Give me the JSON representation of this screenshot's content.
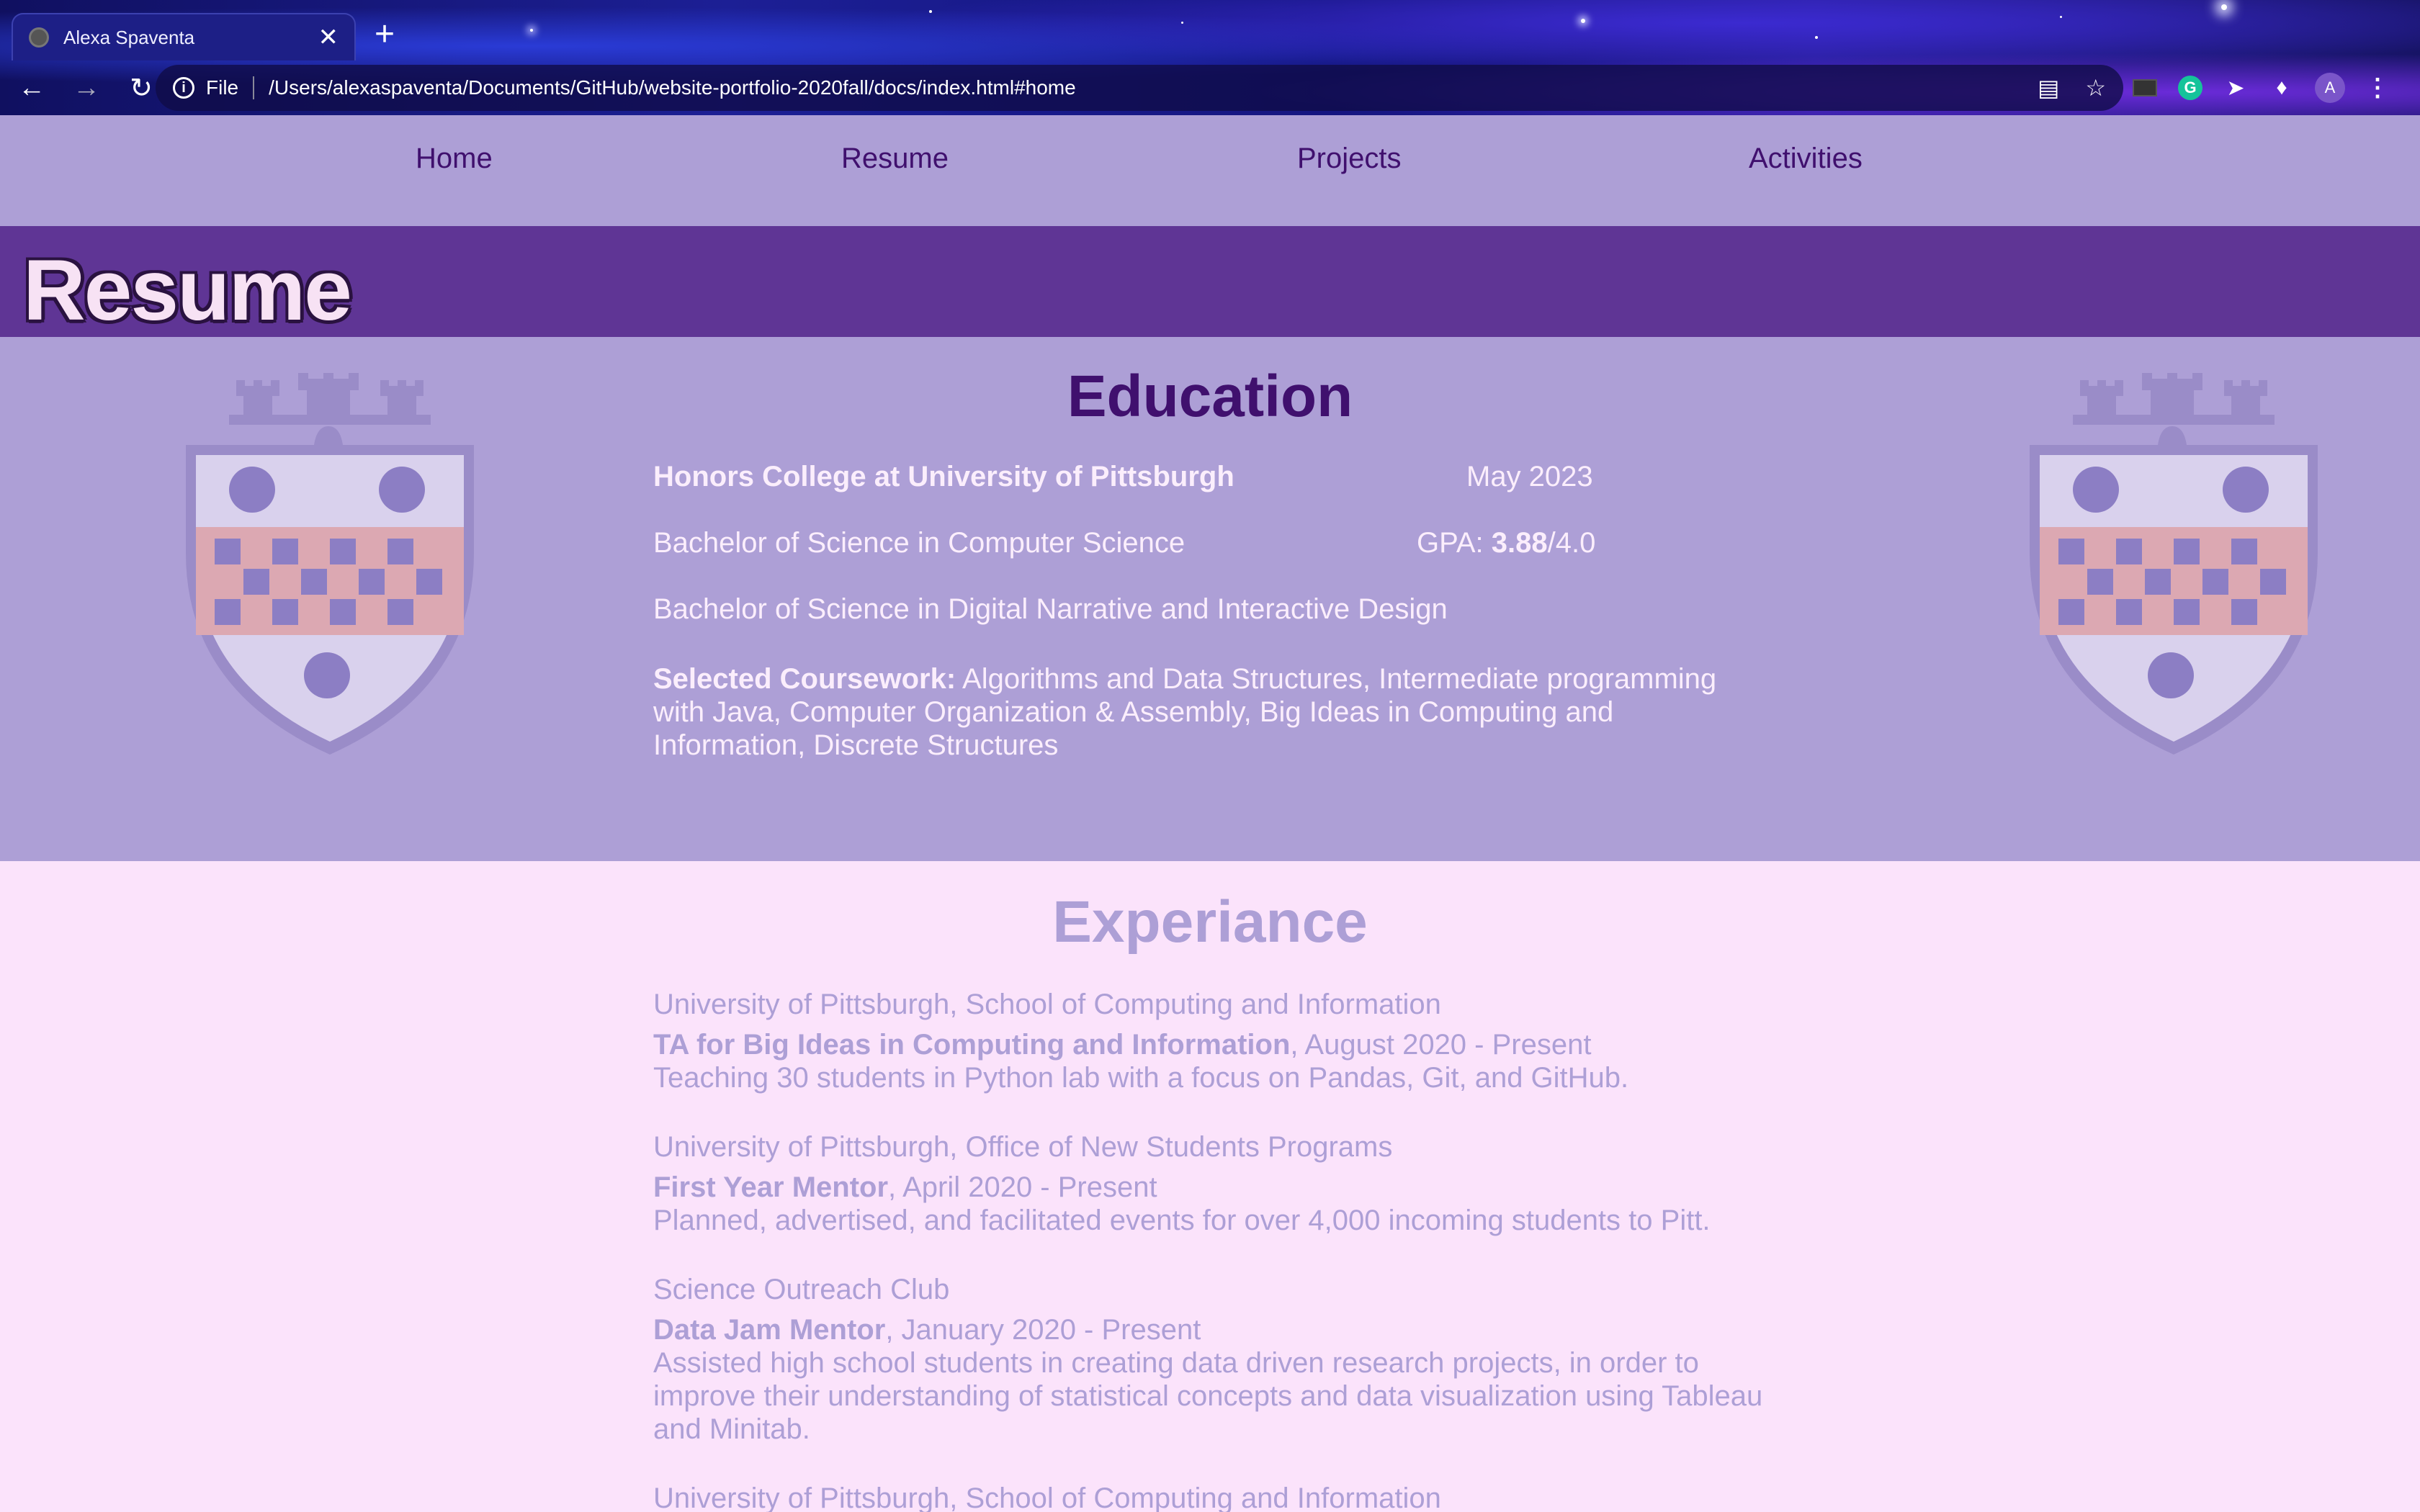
{
  "browser": {
    "tab_title": "Alexa Spaventa",
    "close_glyph": "✕",
    "newtab_glyph": "+",
    "scheme_label": "File",
    "url": "/Users/alexaspaventa/Documents/GitHub/website-portfolio-2020fall/docs/index.html#home",
    "avatar_letter": "A",
    "grammarly_letter": "G"
  },
  "nav": {
    "items": [
      "Home",
      "Resume",
      "Projects",
      "Activities"
    ]
  },
  "page": {
    "title": "Resume"
  },
  "education": {
    "heading": "Education",
    "school": "Honors College at University of Pittsburgh",
    "grad_date": "May 2023",
    "degree1": "Bachelor of Science in Computer Science",
    "gpa_label": "GPA: ",
    "gpa_value": "3.88",
    "gpa_scale": "/4.0",
    "degree2": "Bachelor of Science in Digital Narrative and Interactive Design",
    "coursework_label": "Selected Coursework:",
    "coursework": " Algorithms and Data Structures, Intermediate programming with Java, Computer Organization & Assembly, Big Ideas in Computing and Information, Discrete Structures"
  },
  "experience": {
    "heading": "Experiance",
    "jobs": [
      {
        "org": "University of Pittsburgh, School of Computing and Information",
        "role": "TA for Big Ideas in Computing and Information",
        "dates": ", August 2020 - Present",
        "desc": "Teaching 30 students in Python lab with a focus on Pandas, Git, and GitHub."
      },
      {
        "org": "University of Pittsburgh, Office of New Students Programs",
        "role": "First Year Mentor",
        "dates": ", April 2020 - Present",
        "desc": "Planned, advertised, and facilitated events for over 4,000 incoming students to Pitt."
      },
      {
        "org": "Science Outreach Club",
        "role": "Data Jam Mentor",
        "dates": ", January 2020 - Present",
        "desc": "Assisted high school students in creating data driven research projects, in order to improve their understanding of statistical concepts and data visualization using Tableau and Minitab."
      },
      {
        "org": "University of Pittsburgh, School of Computing and Information"
      }
    ]
  },
  "colors": {
    "nav_bg": "#ad9fd6",
    "title_band": "#5f3595",
    "heading_dark": "#40106e",
    "page_bg": "#fbe3fb"
  }
}
